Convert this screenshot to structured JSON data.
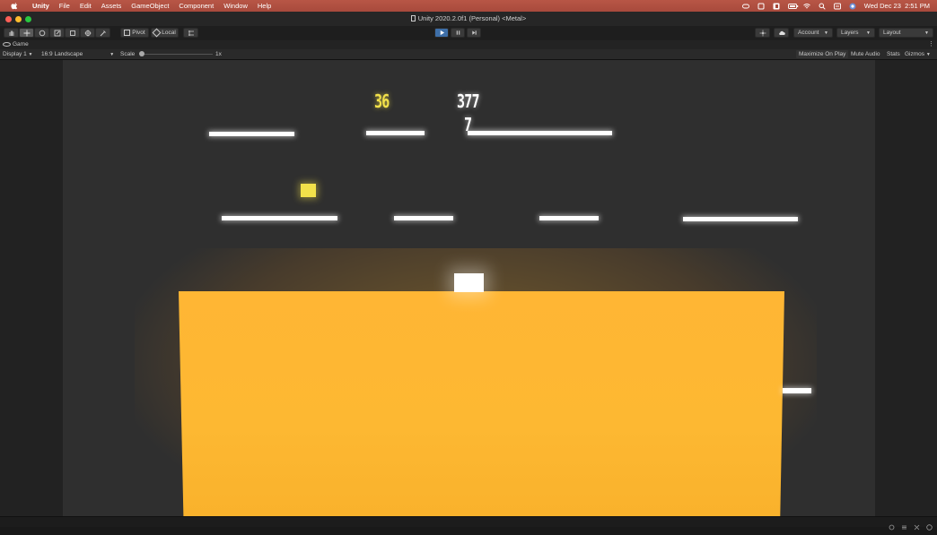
{
  "menubar": {
    "app_name": "Unity",
    "items": [
      "File",
      "Edit",
      "Assets",
      "GameObject",
      "Component",
      "Window",
      "Help"
    ],
    "clock": "Wed Dec 23  2:51 PM"
  },
  "window": {
    "title": "Unity 2020.2.0f1 (Personal) <Metal>"
  },
  "toolbar": {
    "pivot_label": "Pivot",
    "local_label": "Local",
    "account_label": "Account",
    "layers_label": "Layers",
    "layout_label": "Layout"
  },
  "game_tab": {
    "label": "Game"
  },
  "game_bar": {
    "display": "Display 1",
    "aspect": "16:9 Landscape",
    "scale_label": "Scale",
    "scale_value": "1x",
    "maximize": "Maximize On Play",
    "mute": "Mute Audio",
    "stats": "Stats",
    "gizmos": "Gizmos"
  },
  "game": {
    "score_left": "36",
    "score_right": "377",
    "score_sub": "7"
  },
  "colors": {
    "lava": "#fdb832",
    "score_yellow": "#f2e14a",
    "play_active": "#3e6fa8"
  }
}
